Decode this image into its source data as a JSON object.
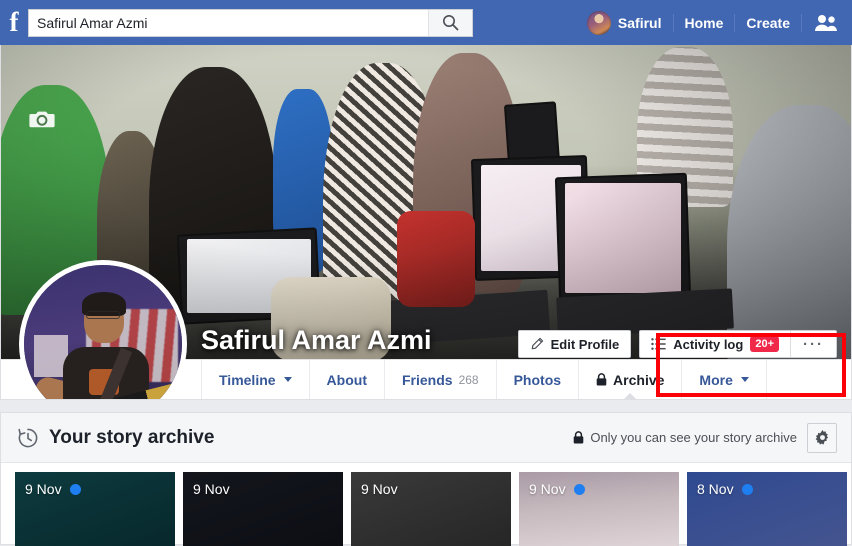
{
  "topbar": {
    "logo": "f",
    "logo_icon": "facebook-logo-icon",
    "search": {
      "value": "Safirul Amar Azmi",
      "placeholder": "Search",
      "icon": "search-icon"
    },
    "profile_name": "Safirul",
    "home_label": "Home",
    "create_label": "Create",
    "friend_requests_icon": "friend-requests-icon",
    "background": "#4267b2"
  },
  "cover": {
    "camera_icon": "camera-icon"
  },
  "profile": {
    "name": "Safirul Amar Azmi",
    "avatar": "profile-picture"
  },
  "actions": {
    "edit_profile_label": "Edit Profile",
    "edit_profile_icon": "pencil-icon",
    "activity_log_label": "Activity log",
    "activity_log_icon": "list-icon",
    "activity_badge": "20+",
    "badge_color": "#f02849",
    "more_label": "···",
    "highlight_color": "#fb0007"
  },
  "tabs": [
    {
      "label": "Timeline",
      "caret": true,
      "active": false,
      "lock": false,
      "count": ""
    },
    {
      "label": "About",
      "caret": false,
      "active": false,
      "lock": false,
      "count": ""
    },
    {
      "label": "Friends",
      "caret": false,
      "active": false,
      "lock": false,
      "count": "268"
    },
    {
      "label": "Photos",
      "caret": false,
      "active": false,
      "lock": false,
      "count": ""
    },
    {
      "label": "Archive",
      "caret": false,
      "active": true,
      "lock": true,
      "count": ""
    },
    {
      "label": "More",
      "caret": true,
      "active": false,
      "lock": false,
      "count": ""
    }
  ],
  "archive": {
    "title": "Your story archive",
    "title_icon": "history-clock-icon",
    "privacy_text": "Only you can see your story archive",
    "privacy_icon": "lock-icon",
    "settings_icon": "gear-icon",
    "stories": [
      {
        "date": "9 Nov",
        "seen": true,
        "color_start": "#0d3b3f",
        "color_end": "#07282c",
        "light": false
      },
      {
        "date": "9 Nov",
        "seen": false,
        "color_start": "#14161d",
        "color_end": "#0c0e14",
        "light": false
      },
      {
        "date": "9 Nov",
        "seen": false,
        "color_start": "#3a3a3a",
        "color_end": "#262626",
        "light": false
      },
      {
        "date": "9 Nov",
        "seen": true,
        "color_start": "#a99aa6",
        "color_end": "#ddd2d6",
        "light": true
      },
      {
        "date": "8 Nov",
        "seen": true,
        "color_start": "#2f4a91",
        "color_end": "#42538f",
        "light": false
      }
    ]
  }
}
